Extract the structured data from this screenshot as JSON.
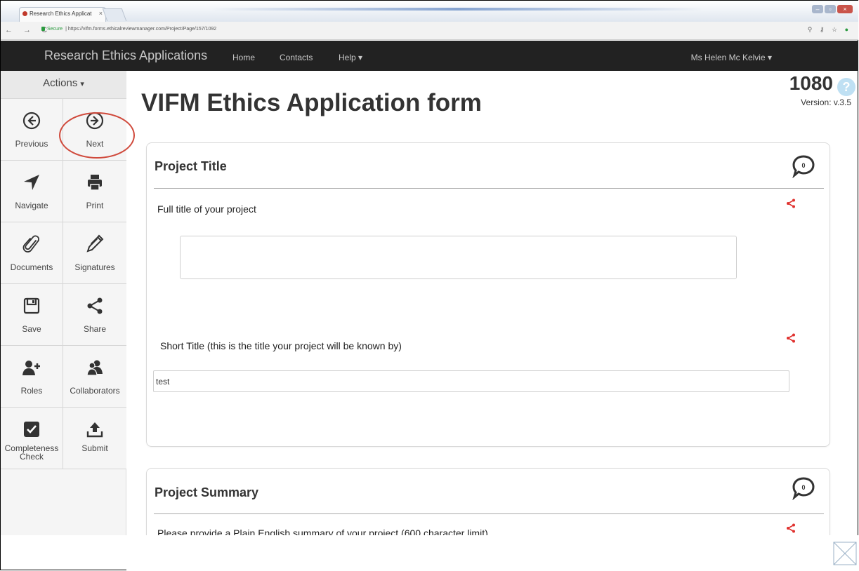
{
  "browser": {
    "tab_title": "Research Ethics Applicat",
    "tab_close": "×",
    "nav_buttons": "← → C",
    "secure_label": "Secure",
    "url": "https://vifm.forms.ethicalreviewmanager.com/Project/Page/157/1092",
    "right_icons": "⚲ ⚷ ☆"
  },
  "navbar": {
    "brand": "Research Ethics Applications",
    "home": "Home",
    "contacts": "Contacts",
    "help": "Help ▾",
    "user": "Ms Helen Mc Kelvie ▾"
  },
  "sidebar": {
    "actions_label": "Actions",
    "buttons": [
      {
        "label": "Previous",
        "icon": "arrow-left-circle"
      },
      {
        "label": "Next",
        "icon": "arrow-right-circle"
      },
      {
        "label": "Navigate",
        "icon": "location-arrow"
      },
      {
        "label": "Print",
        "icon": "printer"
      },
      {
        "label": "Documents",
        "icon": "paperclip"
      },
      {
        "label": "Signatures",
        "icon": "pencil"
      },
      {
        "label": "Save",
        "icon": "floppy-disk"
      },
      {
        "label": "Share",
        "icon": "share"
      },
      {
        "label": "Roles",
        "icon": "user-plus"
      },
      {
        "label": "Collaborators",
        "icon": "users"
      },
      {
        "label": "Completeness Check",
        "icon": "check-square"
      },
      {
        "label": "Submit",
        "icon": "upload"
      }
    ]
  },
  "main": {
    "title": "VIFM Ethics Application form",
    "app_number": "1080",
    "help_glyph": "?",
    "version": "Version: v.3.5",
    "sections": [
      {
        "title": "Project Title",
        "comment_count": "0",
        "questions": [
          {
            "label": "Full title of your project",
            "value": ""
          },
          {
            "label": "Short Title (this is the title your project will be known by)",
            "value": "test"
          }
        ]
      },
      {
        "title": "Project Summary",
        "comment_count": "0",
        "questions": [
          {
            "label": "Please provide a Plain English summary of your project (600 character limit)"
          }
        ]
      }
    ]
  },
  "colors": {
    "navbar_bg": "#222222",
    "accent_red": "#e0312e",
    "highlight_ring": "#d04a3c"
  }
}
